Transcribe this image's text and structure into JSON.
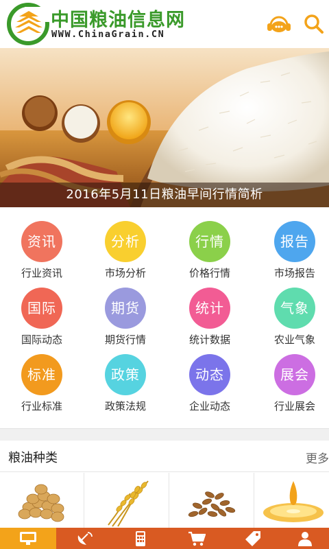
{
  "header": {
    "brand_name": "中国粮油信息网",
    "brand_url": "WWW.ChinaGrain.CN",
    "icons": {
      "service": "customer-service-icon",
      "search": "search-icon"
    },
    "accent_color": "#f3a31a"
  },
  "banner": {
    "caption": "2016年5月11日粮油早间行情简析"
  },
  "categories": [
    {
      "icon_text": "资讯",
      "label": "行业资讯",
      "color": "#f0745e"
    },
    {
      "icon_text": "分析",
      "label": "市场分析",
      "color": "#f9cf2f"
    },
    {
      "icon_text": "行情",
      "label": "价格行情",
      "color": "#8bd04a"
    },
    {
      "icon_text": "报告",
      "label": "市场报告",
      "color": "#4ea6ee"
    },
    {
      "icon_text": "国际",
      "label": "国际动态",
      "color": "#f06755"
    },
    {
      "icon_text": "期货",
      "label": "期货行情",
      "color": "#9a9ade"
    },
    {
      "icon_text": "统计",
      "label": "统计数据",
      "color": "#f25c94"
    },
    {
      "icon_text": "气象",
      "label": "农业气象",
      "color": "#5fdcae"
    },
    {
      "icon_text": "标准",
      "label": "行业标准",
      "color": "#f29a1e"
    },
    {
      "icon_text": "政策",
      "label": "政策法规",
      "color": "#56d3e0"
    },
    {
      "icon_text": "动态",
      "label": "企业动态",
      "color": "#7b74ea"
    },
    {
      "icon_text": "展会",
      "label": "行业展会",
      "color": "#cc6ee2"
    }
  ],
  "section": {
    "title": "粮油种类",
    "more": "更多"
  },
  "products": [
    {
      "icon": "soybean-image"
    },
    {
      "icon": "wheat-image"
    },
    {
      "icon": "grain-seeds-image"
    },
    {
      "icon": "cooking-oil-image"
    }
  ],
  "bottom_nav": {
    "active_color": "#f3a31a",
    "bar_color": "#d95a22",
    "items": [
      {
        "icon": "monitor-icon"
      },
      {
        "icon": "satellite-dish-icon"
      },
      {
        "icon": "calculator-icon"
      },
      {
        "icon": "shopping-cart-icon"
      },
      {
        "icon": "price-tag-icon"
      },
      {
        "icon": "user-icon"
      }
    ]
  }
}
